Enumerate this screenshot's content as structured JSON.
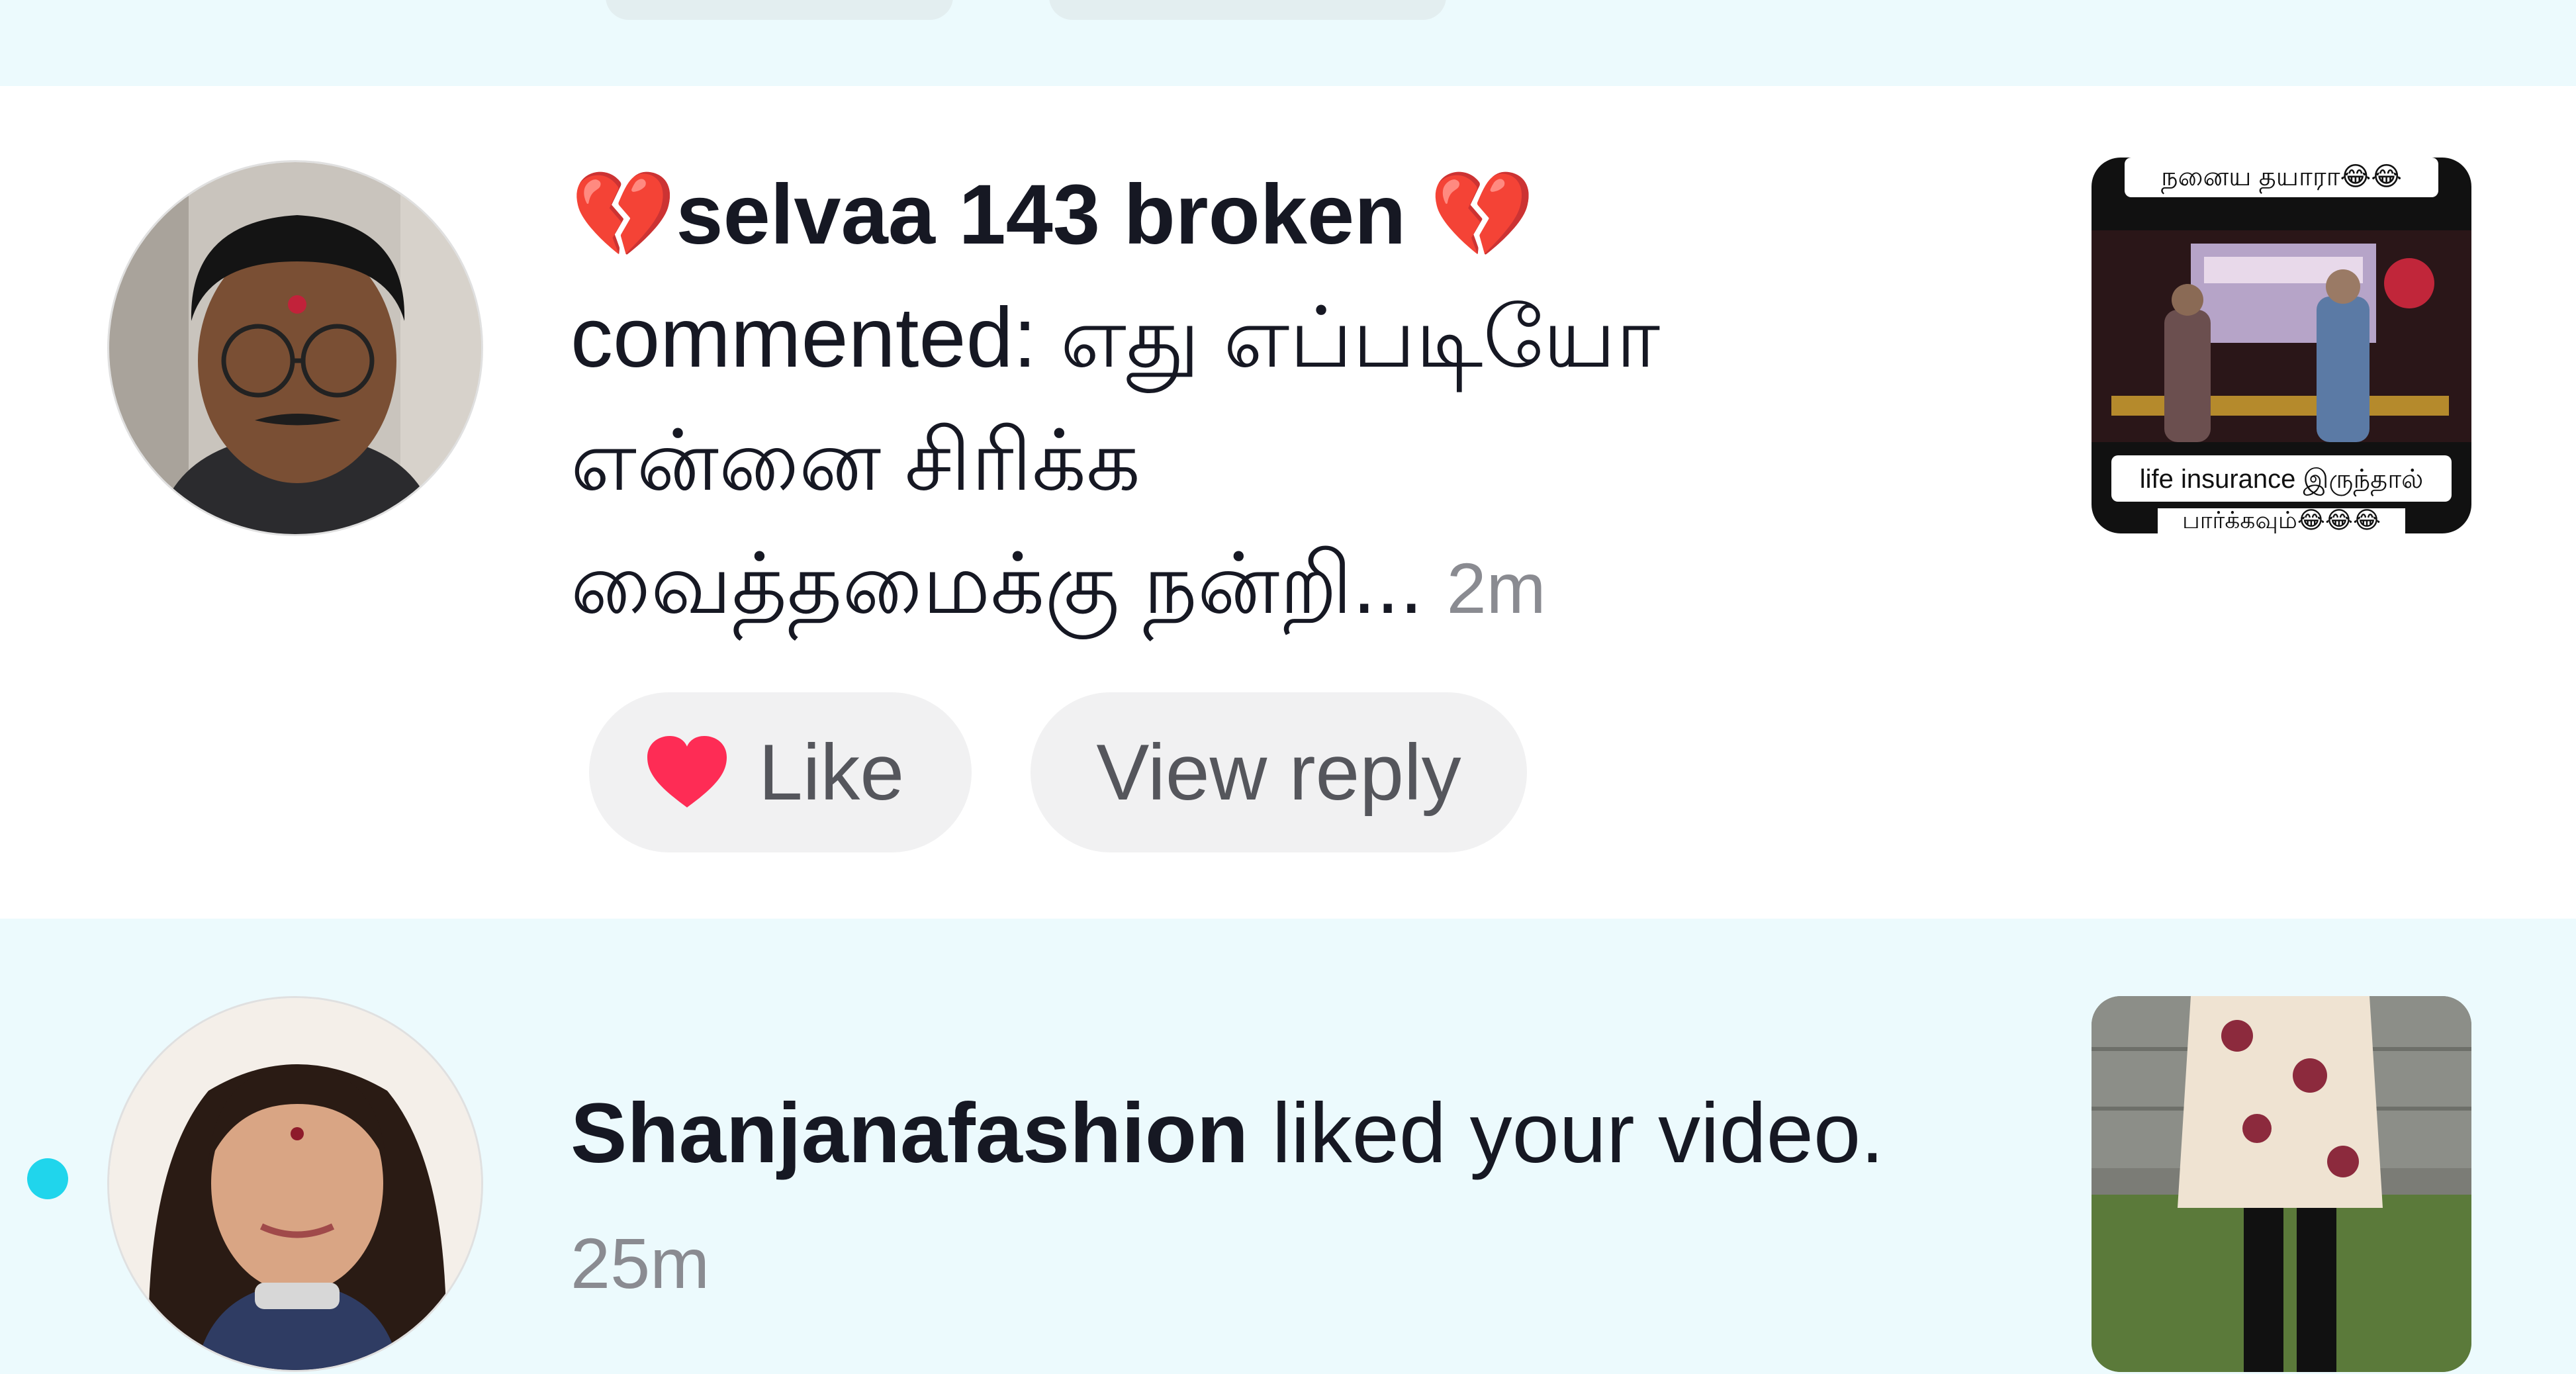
{
  "notifications": [
    {
      "username": "💔selvaa 143 broken 💔",
      "name_prefix_emoji": "broken-heart-icon",
      "name_suffix_emoji": "broken-heart-icon",
      "action": "commented:",
      "comment_line1": "எது எப்படியோ",
      "comment_line2": "என்னை சிரிக்க",
      "comment_line3": "வைத்தமைக்கு நன்றி...",
      "time": "2m",
      "like_label": "Like",
      "view_reply_label": "View reply",
      "thumb_top_caption": "நனைய தயாரா😂😂",
      "thumb_bottom_caption": "life insurance இருந்தால்",
      "thumb_bottom_caption2": "பார்க்கவும்😂😂😂"
    },
    {
      "username": "Shanjanafashion",
      "action": "liked your video.",
      "time": "25m",
      "unread": true
    }
  ],
  "colors": {
    "unread_band": "#ecfafd",
    "unread_dot": "#20d5ec",
    "heart": "#fe2c55",
    "muted_text": "#8a8b91"
  }
}
